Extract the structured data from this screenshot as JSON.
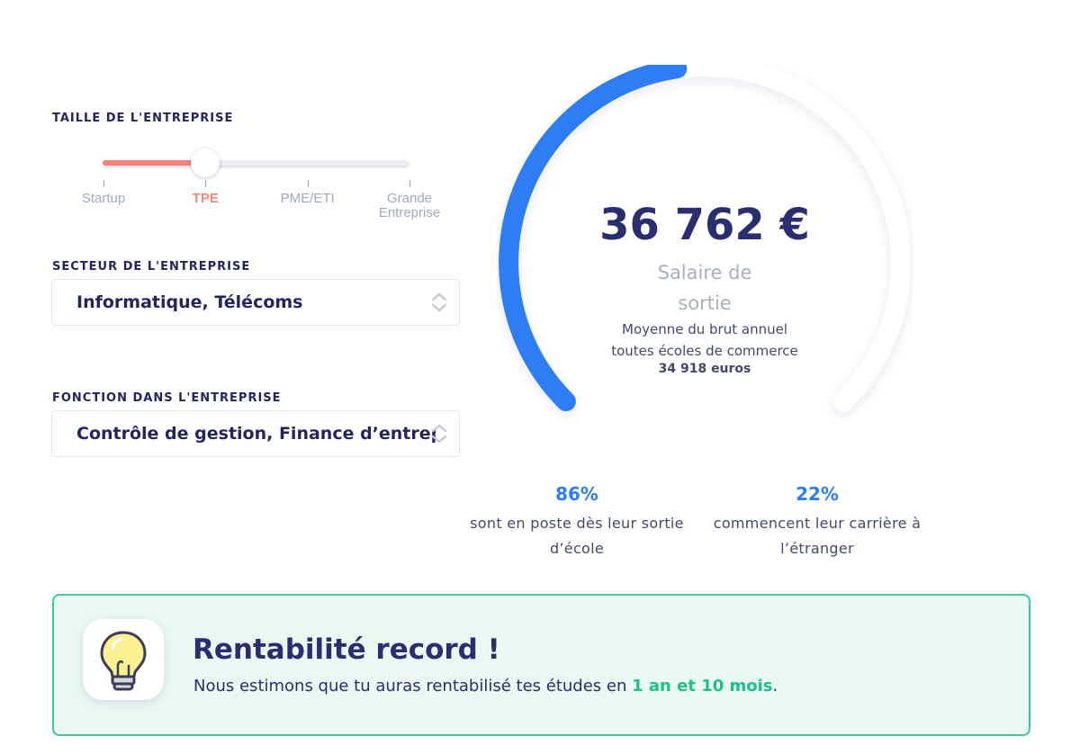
{
  "company_size": {
    "label": "TAILLE DE L'ENTREPRISE",
    "options": [
      "Startup",
      "TPE",
      "PME/ETI",
      "Grande Entreprise"
    ],
    "selected": "TPE"
  },
  "sector": {
    "label": "SECTEUR DE L'ENTREPRISE",
    "value": "Informatique, Télécoms"
  },
  "function": {
    "label": "FONCTION DANS L'ENTREPRISE",
    "value": "Contrôle de gestion, Finance d’entreprise"
  },
  "gauge": {
    "value": "36 762 €",
    "caption": "Salaire de sortie",
    "subtitle_line1": "Moyenne du brut annuel",
    "subtitle_line2": "toutes écoles de commerce",
    "subtitle_bold": "34 918 euros",
    "fill_fraction": 0.47
  },
  "stats": [
    {
      "pct": "86%",
      "text": "sont en poste dès leur sortie d’école"
    },
    {
      "pct": "22%",
      "text": "commencent leur carrière à l’étranger"
    }
  ],
  "banner": {
    "title": "Rentabilité record !",
    "text_before": "Nous estimons que tu auras rentabilisé tes études en ",
    "highlight": "1 an et 10 mois",
    "text_after": "."
  },
  "colors": {
    "accent_blue": "#2f7df2",
    "slider_orange": "#f2857a",
    "banner_green": "#3fc99b",
    "navy": "#2a2d6e"
  },
  "icons": {
    "banner": "lightbulb-icon",
    "select": "chevron-updown-icon"
  }
}
